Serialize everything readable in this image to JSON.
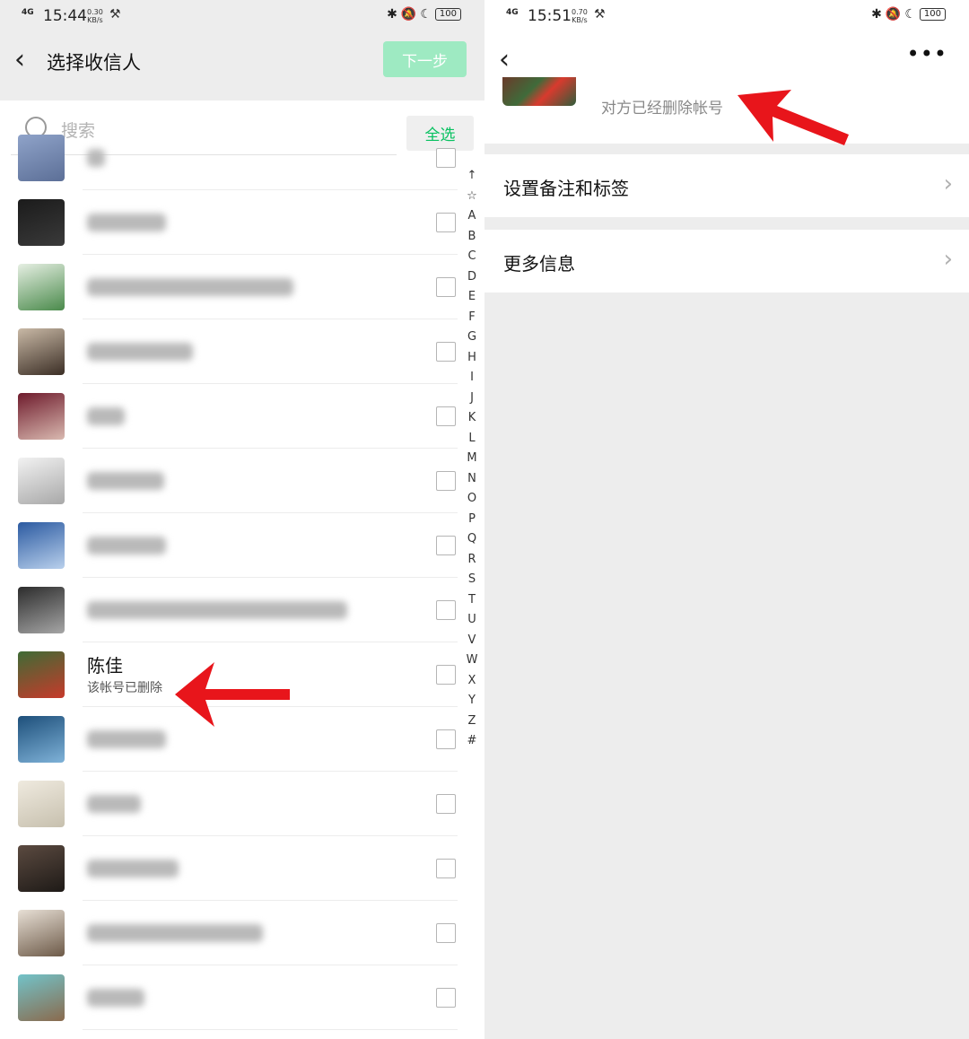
{
  "left": {
    "status": {
      "network": "4G",
      "time": "15:44",
      "speed": "0.30",
      "speed_unit": "KB/s",
      "battery": "100"
    },
    "header": {
      "title": "选择收信人",
      "next_label": "下一步"
    },
    "search": {
      "placeholder": "搜索",
      "select_all": "全选"
    },
    "contacts": [
      {
        "kind": "hidden"
      },
      {
        "kind": "hidden"
      },
      {
        "kind": "hidden"
      },
      {
        "kind": "hidden"
      },
      {
        "kind": "hidden"
      },
      {
        "kind": "hidden"
      },
      {
        "kind": "hidden"
      },
      {
        "kind": "hidden"
      },
      {
        "kind": "deleted",
        "name": "陈佳",
        "note": "该帐号已删除"
      },
      {
        "kind": "hidden"
      },
      {
        "kind": "hidden"
      },
      {
        "kind": "hidden"
      },
      {
        "kind": "hidden"
      },
      {
        "kind": "hidden"
      }
    ],
    "alphabet": [
      "↑",
      "☆",
      "A",
      "B",
      "C",
      "D",
      "E",
      "F",
      "G",
      "H",
      "I",
      "J",
      "K",
      "L",
      "M",
      "N",
      "O",
      "P",
      "Q",
      "R",
      "S",
      "T",
      "U",
      "V",
      "W",
      "X",
      "Y",
      "Z",
      "#"
    ]
  },
  "right": {
    "status": {
      "network": "4G",
      "time": "15:51",
      "speed": "0.70",
      "speed_unit": "KB/s",
      "battery": "100"
    },
    "profile": {
      "deleted_note": "对方已经删除帐号"
    },
    "menu": [
      {
        "label": "设置备注和标签"
      },
      {
        "label": "更多信息"
      }
    ]
  },
  "colors": {
    "wechat_green": "#07c160",
    "next_disabled": "#9eeac2",
    "arrow_red": "#e8151b"
  }
}
